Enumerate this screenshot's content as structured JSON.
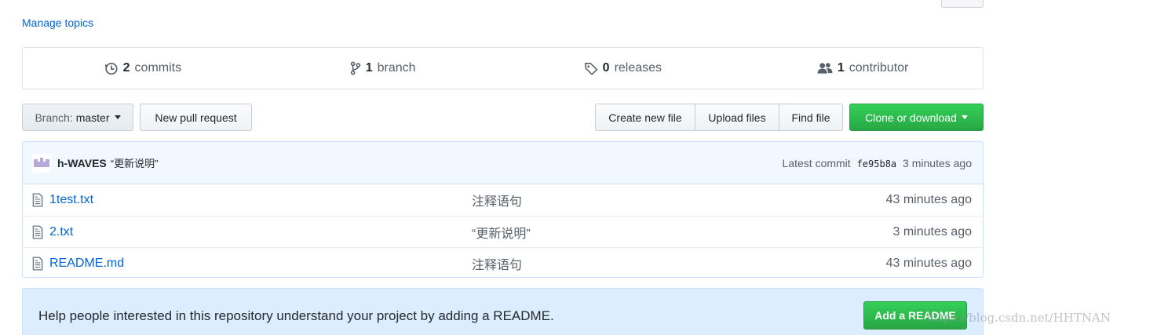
{
  "topics": {
    "manage_label": "Manage topics"
  },
  "numbers_summary": {
    "commits": {
      "count": "2",
      "label": "commits",
      "icon": "history-icon"
    },
    "branches": {
      "count": "1",
      "label": "branch",
      "icon": "git-branch-icon"
    },
    "releases": {
      "count": "0",
      "label": "releases",
      "icon": "tag-icon"
    },
    "contributors": {
      "count": "1",
      "label": "contributor",
      "icon": "people-icon"
    }
  },
  "toolbar": {
    "branch_prefix": "Branch:",
    "branch_value": "master",
    "new_pull_request": "New pull request",
    "create_new_file": "Create new file",
    "upload_files": "Upload files",
    "find_file": "Find file",
    "clone_or_download": "Clone or download"
  },
  "latest_commit": {
    "author": "h-WAVES",
    "message": "“更新说明”",
    "prefix": "Latest commit",
    "sha": "fe95b8a",
    "age": "3 minutes ago"
  },
  "files": [
    {
      "name": "1test.txt",
      "message": "注释语句",
      "age": "43 minutes ago",
      "icon": "file-icon"
    },
    {
      "name": "2.txt",
      "message": "“更新说明”",
      "age": "3 minutes ago",
      "icon": "file-icon"
    },
    {
      "name": "README.md",
      "message": "注释语句",
      "age": "43 minutes ago",
      "icon": "file-icon"
    }
  ],
  "readme_prompt": {
    "text": "Help people interested in this repository understand your project by adding a README.",
    "button": "Add a README"
  },
  "watermark": "https://blog.csdn.net/HHTNAN",
  "colors": {
    "link": "#0366d6",
    "primary_green": "#28a745",
    "banner_blue": "#dbedff",
    "muted_text": "#586069"
  }
}
